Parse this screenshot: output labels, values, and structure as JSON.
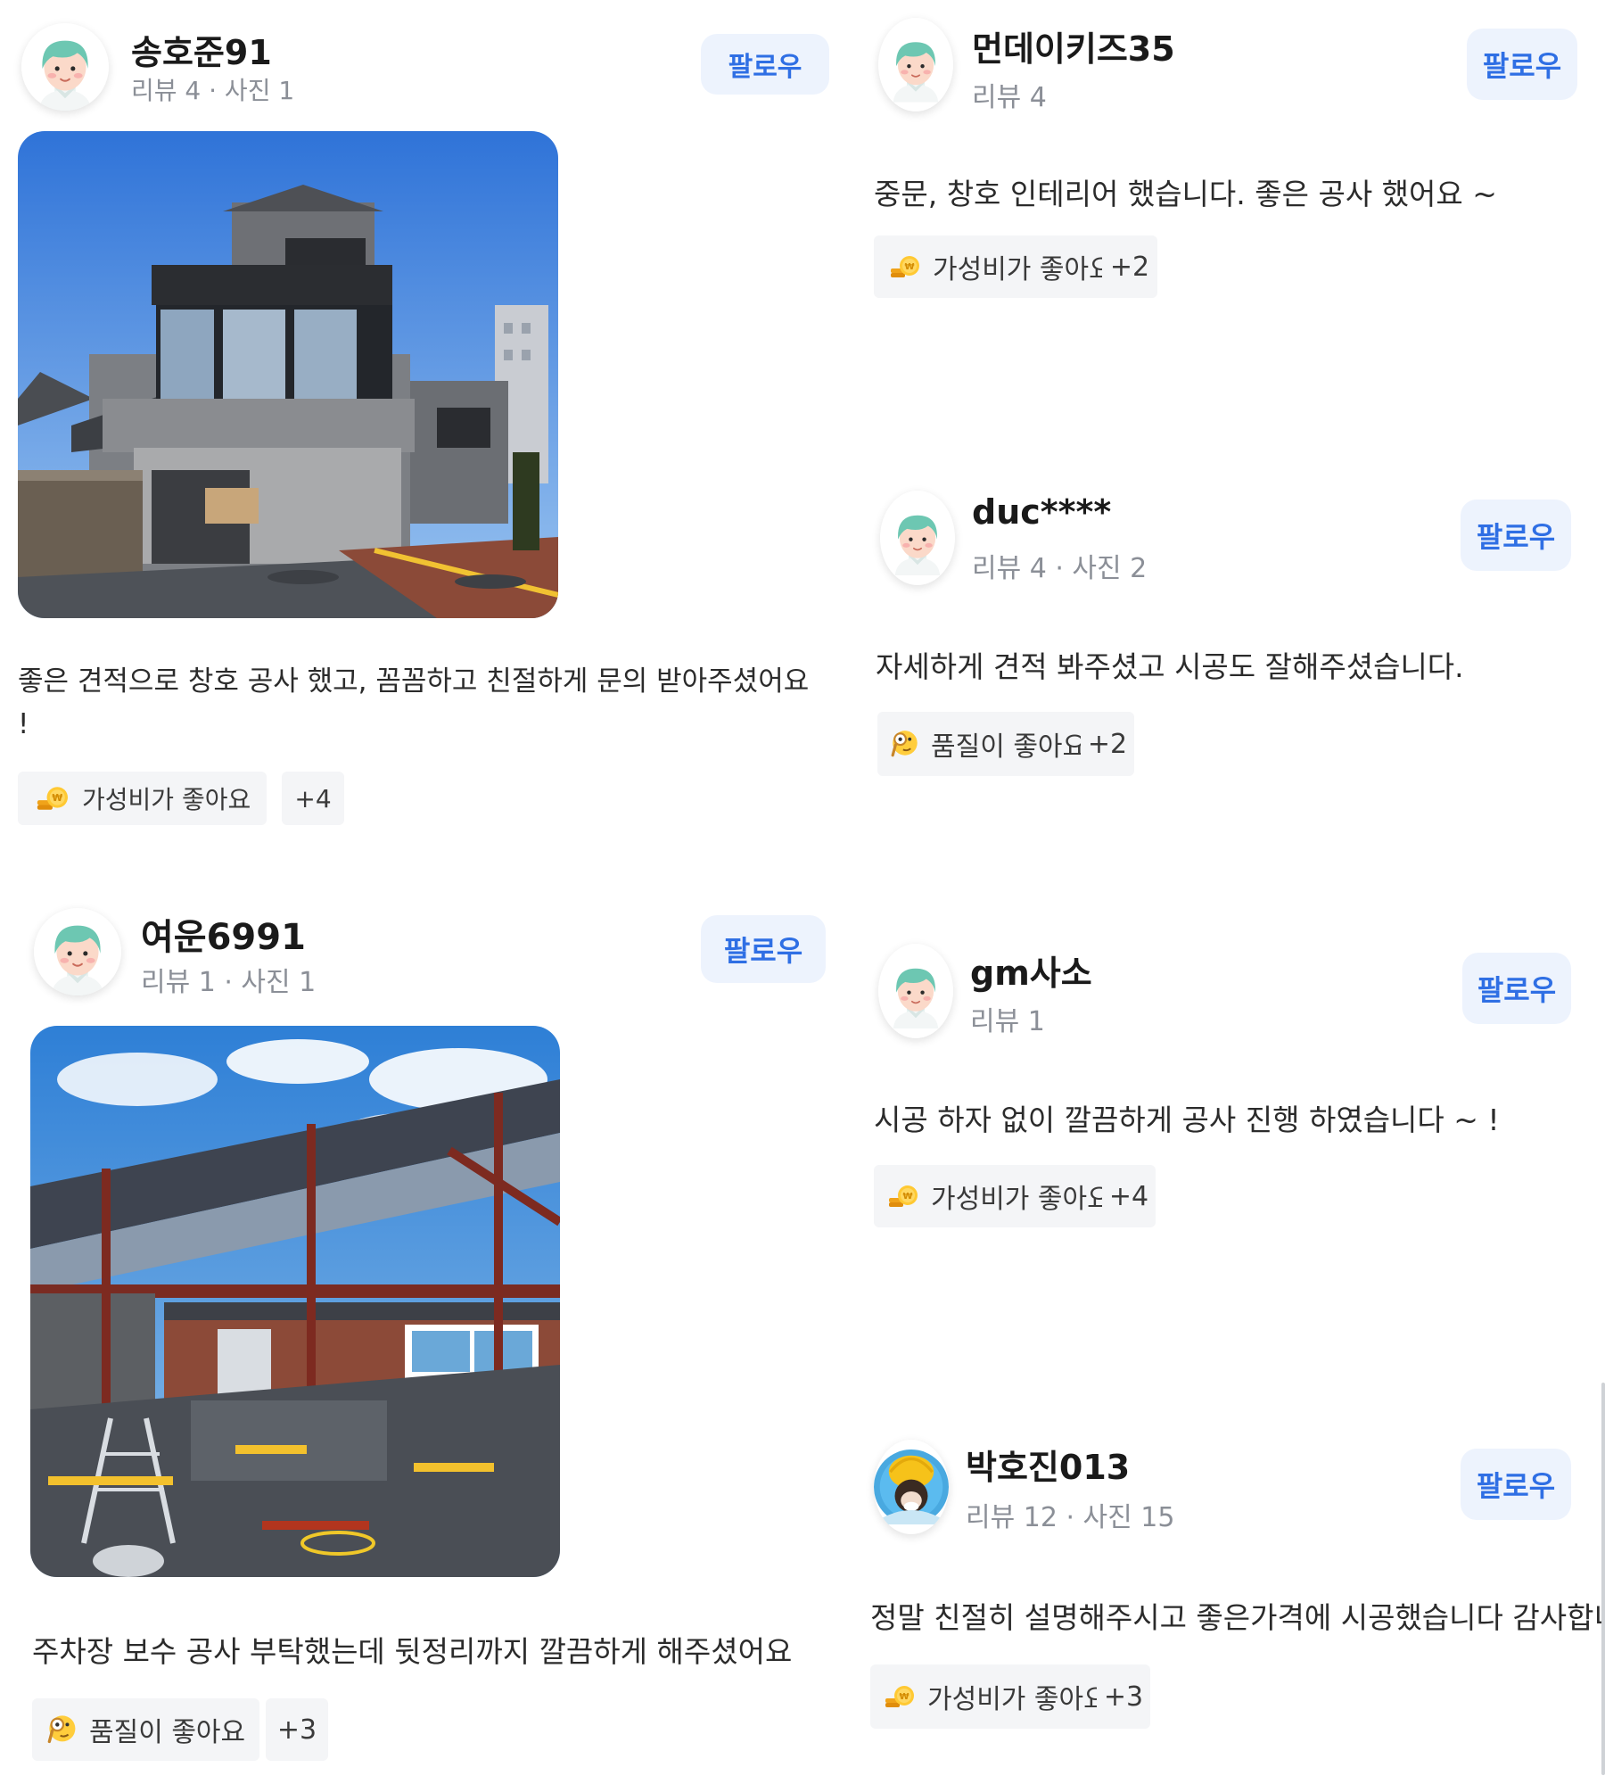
{
  "reviews": [
    {
      "name": "송호준91",
      "meta": "리뷰 4 · 사진 1",
      "follow": "팔로우",
      "text": "좋은 견적으로 창호 공사 했고, 꼼꼼하고 친절하게 문의 받아주셨어요 !",
      "tag": "가성비가 좋아요",
      "tag_icon": "coin-icon",
      "more": "+4"
    },
    {
      "name": "먼데이키즈35",
      "meta": "리뷰 4",
      "follow": "팔로우",
      "text": "중문, 창호 인테리어 했습니다. 좋은 공사 했어요 ~",
      "tag": "가성비가 좋아요",
      "tag_icon": "coin-icon",
      "more": "+2"
    },
    {
      "name": "duc****",
      "meta": "리뷰 4 · 사진 2",
      "follow": "팔로우",
      "text": "자세하게 견적 봐주셨고 시공도 잘해주셨습니다.",
      "tag": "품질이 좋아요",
      "tag_icon": "magnifier-face-icon",
      "more": "+2"
    },
    {
      "name": "여운6991",
      "meta": "리뷰 1 · 사진 1",
      "follow": "팔로우",
      "text": "주차장 보수 공사 부탁했는데 뒷정리까지 깔끔하게 해주셨어요",
      "tag": "품질이 좋아요",
      "tag_icon": "magnifier-face-icon",
      "more": "+3"
    },
    {
      "name": "gm사소",
      "meta": "리뷰 1",
      "follow": "팔로우",
      "text": "시공 하자 없이 깔끔하게 공사 진행 하였습니다 ~ !",
      "tag": "가성비가 좋아요",
      "tag_icon": "coin-icon",
      "more": "+4"
    },
    {
      "name": "박호진013",
      "meta": "리뷰 12 · 사진 15",
      "follow": "팔로우",
      "text": "정말 친절히 설명해주시고 좋은가격에 시공했습니다 감사합니다",
      "tag": "가성비가 좋아요",
      "tag_icon": "coin-icon",
      "more": "+3"
    }
  ],
  "colors": {
    "follow_bg": "#edf3fd",
    "follow_text": "#2f6fe4",
    "meta": "#8b8f97",
    "tag_bg": "#f4f5f7"
  }
}
